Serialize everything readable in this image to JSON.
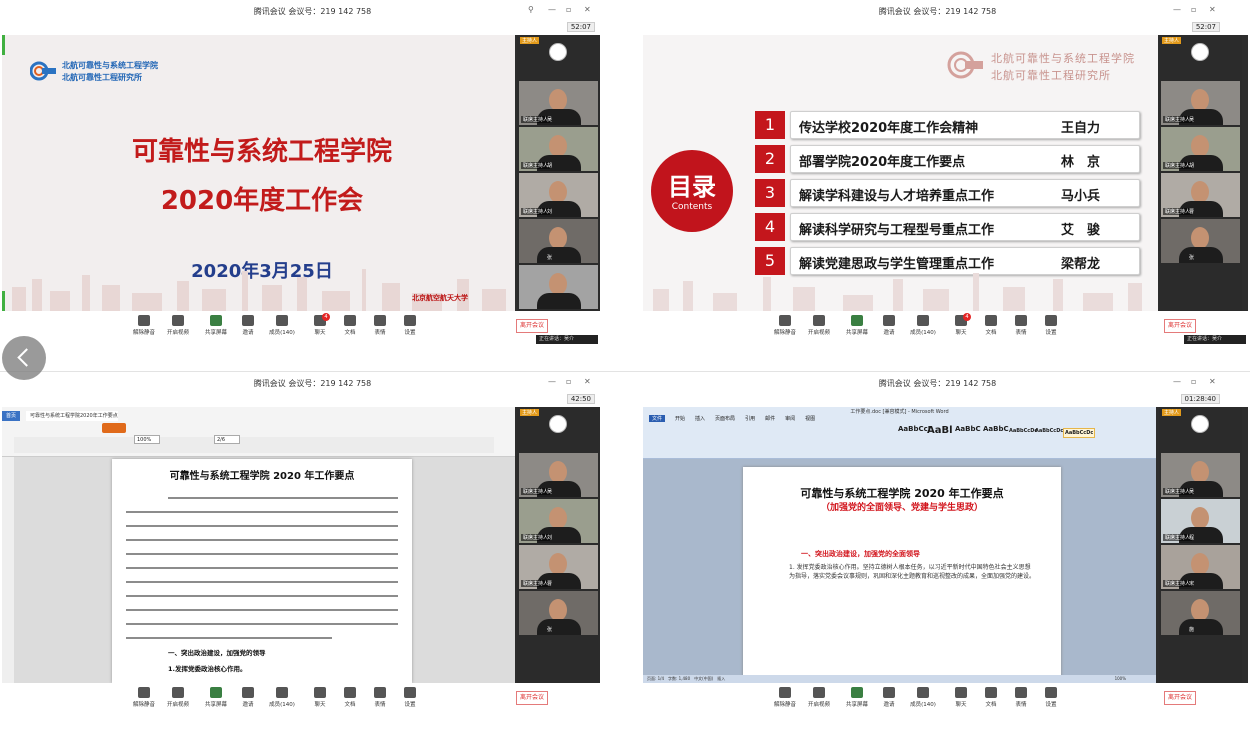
{
  "meeting": {
    "title": "腾讯会议 会议号：219 142 758",
    "clocks": [
      "52:07",
      "52:07",
      "42:50",
      "01:28:40"
    ]
  },
  "participants": {
    "host_tag": "主持人",
    "cohost_tag": "联席主持人",
    "names": [
      "吴",
      "胡",
      "刘",
      "张",
      "曹",
      "程",
      "宋",
      "施"
    ]
  },
  "toolbar": {
    "items": [
      "解除静音",
      "开启视频",
      "共享屏幕",
      "邀请",
      "成员(140)",
      "聊天",
      "文档",
      "表情",
      "设置"
    ],
    "chat_badge": "4",
    "leave_label": "离开会议",
    "speaking": "正在讲话：吴介"
  },
  "slide1": {
    "org_line1": "北航可靠性与系统工程学院",
    "org_line2": "北航可靠性工程研究所",
    "title_line1": "可靠性与系统工程学院",
    "title_line2": "2020年度工作会",
    "date": "2020年3月25日",
    "university": "北京航空航天大学"
  },
  "slide2": {
    "org_line1": "北航可靠性与系统工程学院",
    "org_line2": "北航可靠性工程研究所",
    "badge_big": "目录",
    "badge_small": "Contents",
    "items": [
      {
        "num": "1",
        "topic": "传达学校2020年度工作会精神",
        "name": "王自力"
      },
      {
        "num": "2",
        "topic": "部署学院2020年度工作要点",
        "name": "林　京"
      },
      {
        "num": "3",
        "topic": "解读学科建设与人才培养重点工作",
        "name": "马小兵"
      },
      {
        "num": "4",
        "topic": "解读科学研究与工程型号重点工作",
        "name": "艾　骏"
      },
      {
        "num": "5",
        "topic": "解读党建思政与学生管理重点工作",
        "name": "梁帮龙"
      }
    ]
  },
  "pdf": {
    "tab_home": "首页",
    "tab_doc": "可靠性与系统工程学院2020年工作要点.pdf",
    "page_input": "2/6",
    "zoom": "100%",
    "doc_title": "可靠性与系统工程学院 2020 年工作要点",
    "heading": "一、突出政治建设，加强党的领导",
    "sub": "1.发挥党委政治核心作用。"
  },
  "word": {
    "window_title": "工作要点.doc [兼容模式] - Microsoft Word",
    "tabs": [
      "文件",
      "开始",
      "插入",
      "页面布局",
      "引用",
      "邮件",
      "审阅",
      "视图"
    ],
    "styles": [
      "AaBbCcI",
      "AaBl",
      "AaBbC",
      "AaBbC",
      "AaBbCcDc",
      "AaBbCcDc",
      "AaBbCcDc"
    ],
    "doc_title": "可靠性与系统工程学院 2020 年工作要点",
    "subtitle": "（加强党的全面领导、党建与学生思政）",
    "heading": "一、突出政治建设，加强党的全面领导",
    "para": "1. 发挥党委政治核心作用。坚持立德树人根本任务，以习近平新时代中国特色社会主义思想为指导，落实党委会议事规则，巩固和深化主题教育和巡视整改的成果，全面加强党的建设。",
    "status": "页面: 1/4　字数: 1,480　中文(中国)　插入",
    "zoom": "100%"
  }
}
